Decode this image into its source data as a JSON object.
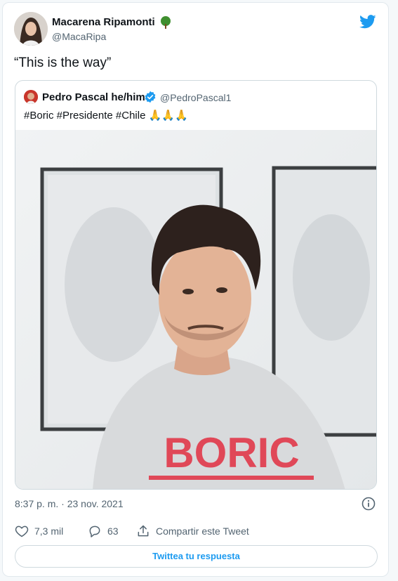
{
  "tweet": {
    "author_name": "Macarena Ripamonti",
    "author_handle": "@MacaRipa",
    "author_badge_icon": "tree-emoji-icon",
    "text": "“This is the way”",
    "timestamp": "8:37 p. m. · 23 nov. 2021"
  },
  "quoted": {
    "author_name": "Pedro Pascal he/him",
    "author_handle": "@PedroPascal1",
    "verified": true,
    "text": "#Boric #Presidente #Chile 🙏🙏🙏",
    "image_shirt_text": "BORIC"
  },
  "actions": {
    "likes": "7,3 mil",
    "replies": "63",
    "share_label": "Compartir este Tweet"
  },
  "reply_button_label": "Twittea tu respuesta",
  "colors": {
    "accent": "#1d9bf0",
    "text": "#0f1419",
    "muted": "#536471",
    "border": "#cfd9de"
  }
}
